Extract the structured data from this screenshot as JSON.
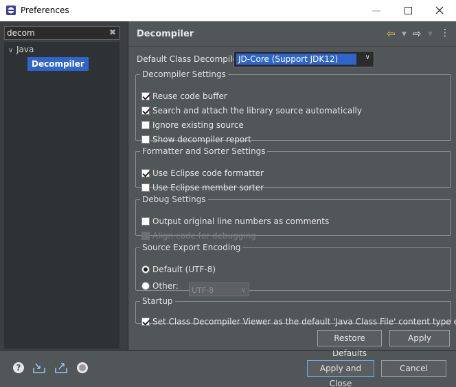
{
  "window": {
    "title": "Preferences"
  },
  "sidebar": {
    "filter_value": "decom",
    "tree": [
      {
        "label": "Java",
        "expanded": true
      },
      {
        "label": "Decompiler",
        "selected": true
      }
    ]
  },
  "page": {
    "title": "Decompiler",
    "default_decompiler_label": "Default Class Decompiler:",
    "default_decompiler_value": "JD-Core (Support JDK12)",
    "groups": {
      "decompiler_settings": {
        "legend": "Decompiler Settings",
        "options": [
          {
            "label": "Reuse code buffer",
            "checked": true
          },
          {
            "label": "Search and attach the library source automatically",
            "checked": true
          },
          {
            "label": "Ignore existing source",
            "checked": false
          },
          {
            "label": "Show decompiler report",
            "checked": false
          }
        ]
      },
      "formatter": {
        "legend": "Formatter and Sorter Settings",
        "options": [
          {
            "label": "Use Eclipse code formatter",
            "checked": true
          },
          {
            "label": "Use Eclipse member sorter",
            "checked": false
          }
        ]
      },
      "debug": {
        "legend": "Debug Settings",
        "options": [
          {
            "label": "Output original line numbers as comments",
            "checked": false
          },
          {
            "label": "Align code for debugging",
            "checked": false,
            "disabled": true
          }
        ]
      },
      "encoding": {
        "legend": "Source Export Encoding",
        "default_label": "Default (UTF-8)",
        "other_label": "Other:",
        "other_value": "UTF-8"
      },
      "startup": {
        "legend": "Startup",
        "option": "Set Class Decompiler Viewer as the default 'Java Class File' content type editor",
        "checked": true
      }
    },
    "restore_defaults": "Restore Defaults",
    "apply": "Apply"
  },
  "footer": {
    "apply_and_close": "Apply and Close",
    "cancel": "Cancel"
  },
  "colors": {
    "panel_bg": "#515658",
    "tree_bg": "#2f3234",
    "selection": "#2f65ca",
    "nav_back": "#f0c040"
  }
}
